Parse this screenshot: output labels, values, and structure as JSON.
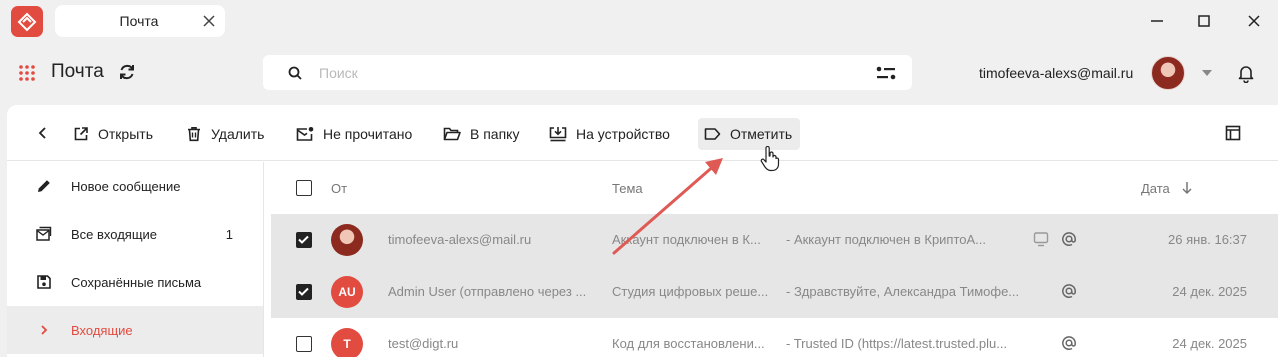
{
  "window": {
    "tab_title": "Почта",
    "controls": [
      "minimize-icon",
      "maximize-icon",
      "close-icon"
    ]
  },
  "header": {
    "app_name": "Почта",
    "search_placeholder": "Поиск",
    "user_email": "timofeeva-alexs@mail.ru"
  },
  "toolbar": {
    "open": "Открыть",
    "delete": "Удалить",
    "unread": "Не прочитано",
    "to_folder": "В папку",
    "to_device": "На устройство",
    "mark": "Отметить"
  },
  "sidebar": {
    "items": [
      {
        "label": "Новое сообщение",
        "count": "",
        "icon": "pencil-icon"
      },
      {
        "label": "Все входящие",
        "count": "1",
        "icon": "mail-stack-icon"
      },
      {
        "label": "Сохранённые письма",
        "count": "",
        "icon": "save-icon"
      },
      {
        "label": "Входящие",
        "count": "",
        "icon": "chevron-right-icon"
      }
    ]
  },
  "list": {
    "columns": {
      "from": "От",
      "subject": "Тема",
      "date": "Дата"
    },
    "rows": [
      {
        "avatar": "",
        "from": "timofeeva-alexs@mail.ru",
        "subject": "Аккаунт подключен в К...",
        "preview": "- Аккаунт подключен в КриптоА...",
        "date": "26 янв. 16:37",
        "selected": true
      },
      {
        "avatar": "AU",
        "from": "Admin User (отправлено через ...",
        "subject": "Студия цифровых реше...",
        "preview": "- Здравствуйте, Александра Тимофе...",
        "date": "24 дек. 2025",
        "selected": true
      },
      {
        "avatar": "T",
        "from": "test@digt.ru",
        "subject": "Код для восстановлени...",
        "preview": "- Trusted ID (https://latest.trusted.plu...",
        "date": "24 дек. 2025",
        "selected": false
      }
    ]
  },
  "colors": {
    "accent": "#e24b3f",
    "background": "#f0f0f0",
    "selected_row": "#e6e6e6"
  }
}
